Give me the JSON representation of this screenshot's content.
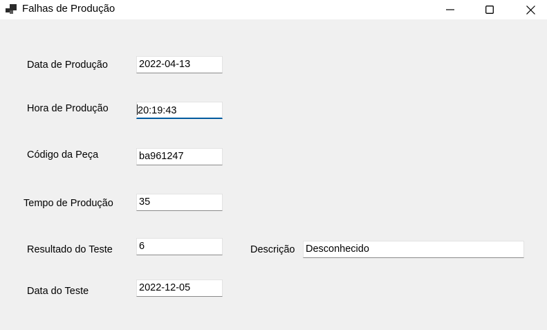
{
  "window": {
    "title": "Falhas de Produção"
  },
  "form": {
    "data_producao": {
      "label": "Data de Produção",
      "value": "2022-04-13"
    },
    "hora_producao": {
      "label": "Hora de Produção",
      "value": "20:19:43"
    },
    "codigo_peca": {
      "label": "Código da Peça",
      "value": "ba961247"
    },
    "tempo_producao": {
      "label": "Tempo de Produção",
      "value": "35"
    },
    "resultado_teste": {
      "label": "Resultado do Teste",
      "value": "6"
    },
    "descricao": {
      "label": "Descrição",
      "value": "Desconhecido"
    },
    "data_teste": {
      "label": "Data do Teste",
      "value": "2022-12-05"
    }
  },
  "colors": {
    "focus_accent": "#005a9e",
    "background": "#f0f0f0",
    "titlebar": "#ffffff"
  },
  "icons": {
    "app": "app-icon",
    "minimize": "minimize-icon",
    "maximize": "maximize-icon",
    "close": "close-icon"
  }
}
